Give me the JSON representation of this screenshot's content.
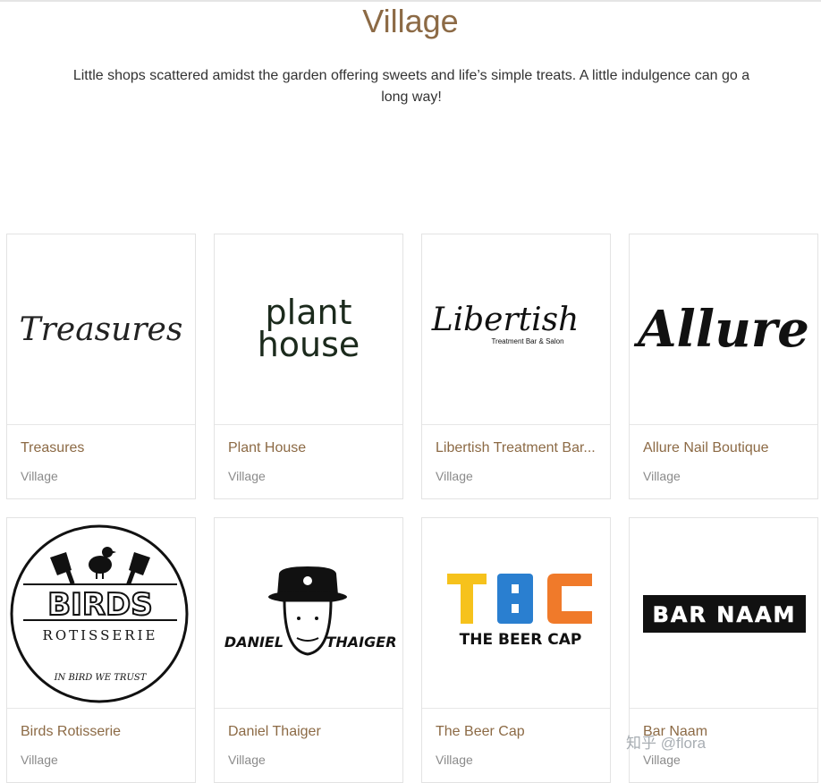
{
  "page": {
    "title": "Village",
    "description": "Little shops scattered amidst the garden offering sweets and life’s simple treats. A little indulgence can go a long way!"
  },
  "shops": [
    {
      "name": "Treasures",
      "category": "Village",
      "logo_text": "Treasures"
    },
    {
      "name": "Plant House",
      "category": "Village",
      "logo_text_1": "plant",
      "logo_text_2": "house"
    },
    {
      "name": "Libertish Treatment Bar...",
      "category": "Village",
      "logo_text": "Libertish",
      "logo_subtext": "Treatment Bar & Salon"
    },
    {
      "name": "Allure Nail Boutique",
      "category": "Village",
      "logo_text": "Allure"
    },
    {
      "name": "Birds Rotisserie",
      "category": "Village",
      "logo_text": "BIRDS",
      "logo_subtext": "ROTISSERIE",
      "logo_tagline": "IN BIRD WE TRUST"
    },
    {
      "name": "Daniel Thaiger",
      "category": "Village",
      "logo_text_1": "DANIEL",
      "logo_text_2": "THAIGER"
    },
    {
      "name": "The Beer Cap",
      "category": "Village",
      "logo_text": "TBC",
      "logo_subtext": "THE BEER CAP"
    },
    {
      "name": "Bar Naam",
      "category": "Village",
      "logo_text": "BAR NAAM"
    }
  ],
  "watermark": "知乎 @flora",
  "colors": {
    "title": "#8c6a45",
    "category": "#8a8a8a",
    "tbc_yellow": "#f6c21c",
    "tbc_blue": "#2a7fd0",
    "tbc_orange": "#f07a2a"
  }
}
